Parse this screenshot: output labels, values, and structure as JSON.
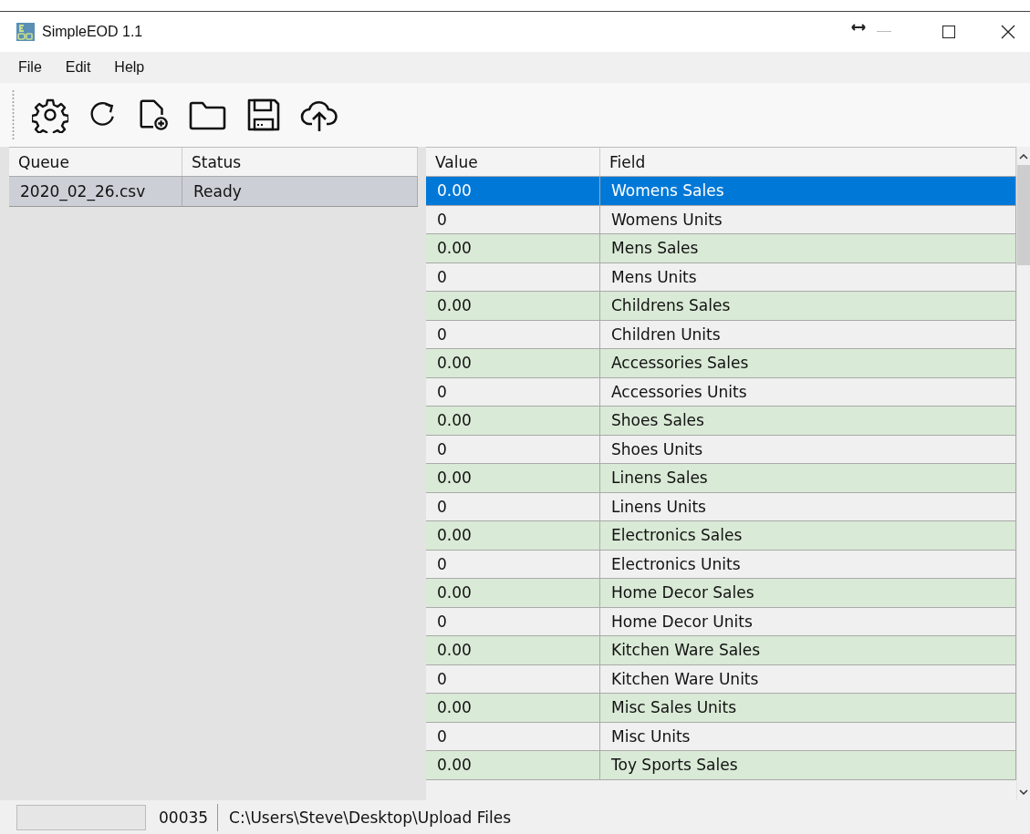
{
  "window": {
    "title": "SimpleEOD 1.1"
  },
  "menu": [
    "File",
    "Edit",
    "Help"
  ],
  "queue": {
    "columns": [
      "Queue",
      "Status"
    ],
    "rows": [
      {
        "file": "2020_02_26.csv",
        "status": "Ready",
        "selected": true
      }
    ]
  },
  "fields": {
    "columns": [
      "Value",
      "Field"
    ],
    "rows": [
      {
        "value": "0.00",
        "field": "Womens Sales",
        "selected": true
      },
      {
        "value": "0",
        "field": "Womens Units",
        "selected": false
      },
      {
        "value": "0.00",
        "field": "Mens Sales",
        "selected": false
      },
      {
        "value": "0",
        "field": "Mens Units",
        "selected": false
      },
      {
        "value": "0.00",
        "field": "Childrens Sales",
        "selected": false
      },
      {
        "value": "0",
        "field": "Children Units",
        "selected": false
      },
      {
        "value": "0.00",
        "field": "Accessories Sales",
        "selected": false
      },
      {
        "value": "0",
        "field": "Accessories Units",
        "selected": false
      },
      {
        "value": "0.00",
        "field": "Shoes Sales",
        "selected": false
      },
      {
        "value": "0",
        "field": "Shoes Units",
        "selected": false
      },
      {
        "value": "0.00",
        "field": "Linens Sales",
        "selected": false
      },
      {
        "value": "0",
        "field": "Linens Units",
        "selected": false
      },
      {
        "value": "0.00",
        "field": "Electronics Sales",
        "selected": false
      },
      {
        "value": "0",
        "field": "Electronics Units",
        "selected": false
      },
      {
        "value": "0.00",
        "field": "Home Decor Sales",
        "selected": false
      },
      {
        "value": "0",
        "field": "Home Decor Units",
        "selected": false
      },
      {
        "value": "0.00",
        "field": "Kitchen Ware Sales",
        "selected": false
      },
      {
        "value": "0",
        "field": "Kitchen Ware Units",
        "selected": false
      },
      {
        "value": "0.00",
        "field": "Misc Sales Units",
        "selected": false
      },
      {
        "value": "0",
        "field": "Misc Units",
        "selected": false
      },
      {
        "value": "0.00",
        "field": "Toy Sports Sales",
        "selected": false
      }
    ]
  },
  "status_bar": {
    "progress": {
      "level": 0
    },
    "count": "00035",
    "path": "C:\\Users\\Steve\\Desktop\\Upload Files"
  }
}
